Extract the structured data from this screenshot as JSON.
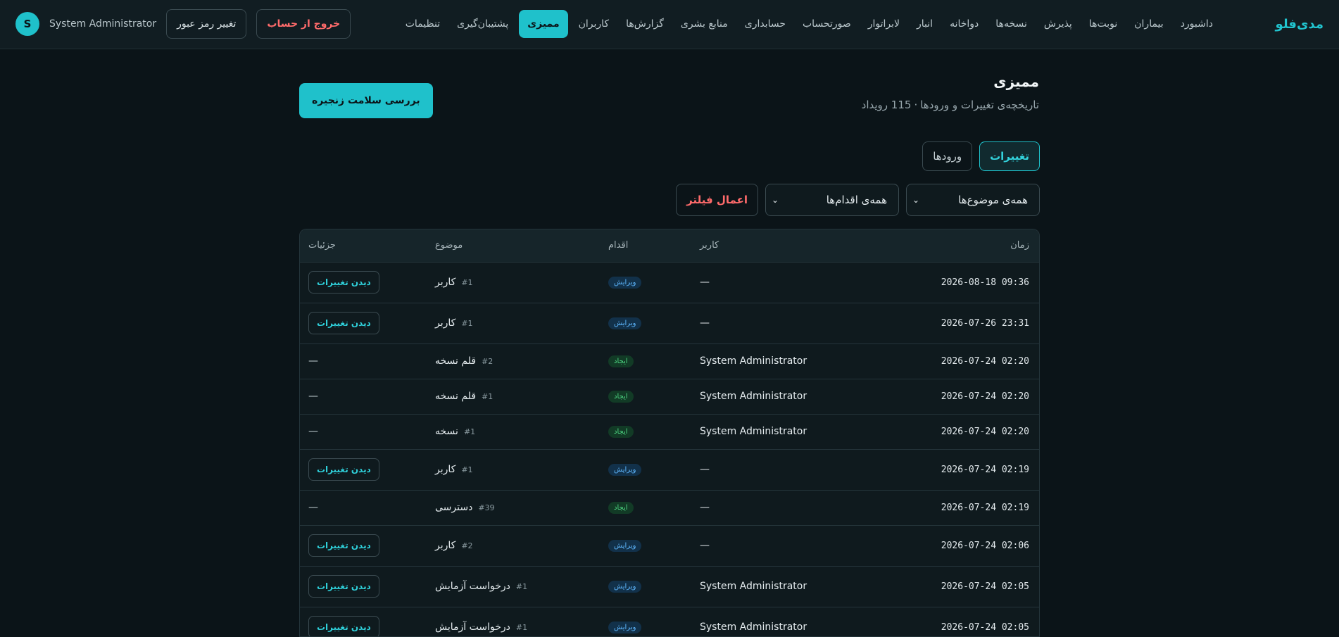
{
  "brand": "مدی‌فلو",
  "nav": [
    {
      "label": "داشبورد",
      "active": false
    },
    {
      "label": "بیماران",
      "active": false
    },
    {
      "label": "نوبت‌ها",
      "active": false
    },
    {
      "label": "پذیرش",
      "active": false
    },
    {
      "label": "نسخه‌ها",
      "active": false
    },
    {
      "label": "دواخانه",
      "active": false
    },
    {
      "label": "انبار",
      "active": false
    },
    {
      "label": "لابراتوار",
      "active": false
    },
    {
      "label": "صورتحساب",
      "active": false
    },
    {
      "label": "حسابداری",
      "active": false
    },
    {
      "label": "منابع بشری",
      "active": false
    },
    {
      "label": "گزارش‌ها",
      "active": false
    },
    {
      "label": "کاربران",
      "active": false
    },
    {
      "label": "ممیزی",
      "active": true
    },
    {
      "label": "پشتیبان‌گیری",
      "active": false
    },
    {
      "label": "تنظیمات",
      "active": false
    }
  ],
  "user": {
    "avatar_letter": "S",
    "name": "System Administrator",
    "change_password": "تغییر رمز عبور",
    "logout": "خروج از حساب"
  },
  "page": {
    "title": "ممیزی",
    "subtitle": "تاریخچه‌ی تغییرات و ورودها",
    "event_count": "115 رویداد",
    "chain_check_button": "بررسی سلامت زنجیره"
  },
  "tabs": [
    {
      "label": "تغییرات",
      "active": true
    },
    {
      "label": "ورودها",
      "active": false
    }
  ],
  "filters": {
    "subject_select": "همه‌ی موضوع‌ها",
    "action_select": "همه‌ی اقدام‌ها",
    "apply": "اعمال فیلتر"
  },
  "table": {
    "columns": {
      "time": "زمان",
      "user": "کاربر",
      "action": "اقدام",
      "subject": "موضوع",
      "details": "جزئیات"
    },
    "view_changes_label": "دیدن تغییرات",
    "empty": "—",
    "rows": [
      {
        "time": "2026-08-18 09:36",
        "user": "—",
        "action": "ویرایش",
        "action_type": "edit",
        "subject": "کاربر",
        "ref": "#1",
        "has_details": true
      },
      {
        "time": "2026-07-26 23:31",
        "user": "—",
        "action": "ویرایش",
        "action_type": "edit",
        "subject": "کاربر",
        "ref": "#1",
        "has_details": true
      },
      {
        "time": "2026-07-24 02:20",
        "user": "System Administrator",
        "action": "ایجاد",
        "action_type": "create",
        "subject": "قلم نسخه",
        "ref": "#2",
        "has_details": false
      },
      {
        "time": "2026-07-24 02:20",
        "user": "System Administrator",
        "action": "ایجاد",
        "action_type": "create",
        "subject": "قلم نسخه",
        "ref": "#1",
        "has_details": false
      },
      {
        "time": "2026-07-24 02:20",
        "user": "System Administrator",
        "action": "ایجاد",
        "action_type": "create",
        "subject": "نسخه",
        "ref": "#1",
        "has_details": false
      },
      {
        "time": "2026-07-24 02:19",
        "user": "—",
        "action": "ویرایش",
        "action_type": "edit",
        "subject": "کاربر",
        "ref": "#1",
        "has_details": true
      },
      {
        "time": "2026-07-24 02:19",
        "user": "—",
        "action": "ایجاد",
        "action_type": "create",
        "subject": "دسترسی",
        "ref": "#39",
        "has_details": false
      },
      {
        "time": "2026-07-24 02:06",
        "user": "—",
        "action": "ویرایش",
        "action_type": "edit",
        "subject": "کاربر",
        "ref": "#2",
        "has_details": true
      },
      {
        "time": "2026-07-24 02:05",
        "user": "System Administrator",
        "action": "ویرایش",
        "action_type": "edit",
        "subject": "درخواست آزمایش",
        "ref": "#1",
        "has_details": true
      },
      {
        "time": "2026-07-24 02:05",
        "user": "System Administrator",
        "action": "ویرایش",
        "action_type": "edit",
        "subject": "درخواست آزمایش",
        "ref": "#1",
        "has_details": true
      }
    ]
  },
  "colors": {
    "accent": "#1fc1cb",
    "background": "#0b1418",
    "danger": "#ff6b6b"
  }
}
